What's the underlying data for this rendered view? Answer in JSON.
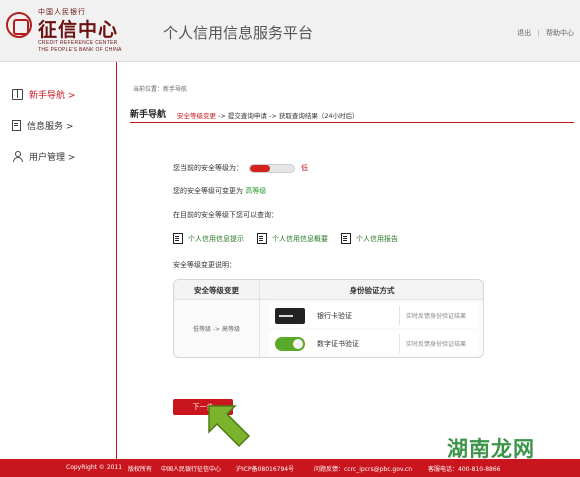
{
  "header": {
    "logo_top": "中国人民银行",
    "logo_cn": "征信中心",
    "logo_en_line1": "CREDIT REFERENCE CENTER",
    "logo_en_line2": "THE PEOPLE'S BANK OF CHINA",
    "platform_title": "个人信用信息服务平台",
    "logout_label": "退出",
    "separator": "|",
    "help_label": "帮助中心"
  },
  "sidebar": {
    "items": [
      {
        "label": "新手导航 >",
        "icon": "book-icon",
        "active": true
      },
      {
        "label": "信息服务 >",
        "icon": "document-icon",
        "active": false
      },
      {
        "label": "用户管理 >",
        "icon": "user-icon",
        "active": false
      }
    ]
  },
  "main": {
    "breadcrumb": "当前位置：新手导航",
    "section_title": "新手导航",
    "steps": {
      "current": "安全等级变更",
      "rest": " -> 提交查询申请 -> 获取查询结果（24小时后）"
    },
    "current_level_label": "您当前的安全等级为：",
    "current_level_value": "低",
    "current_level_fraction": 0.45,
    "upgrade_prefix": "您的安全等级可变更为",
    "upgrade_value": "高等级",
    "query_intro": "在目前的安全等级下您可以查询：",
    "query_items": [
      {
        "label": "个人信用信息提示",
        "icon": "document-icon"
      },
      {
        "label": "个人信用信息概要",
        "icon": "report-icon"
      },
      {
        "label": "个人信用报告",
        "icon": "book-icon"
      }
    ],
    "change_desc_label": "安全等级变更说明：",
    "table": {
      "col1_header": "安全等级变更",
      "col2_header": "身份验证方式",
      "level_change": "低等级 -> 高等级",
      "methods": [
        {
          "name": "银行卡验证",
          "icon": "bank-card-icon",
          "desc": "实时反馈身份验证结果"
        },
        {
          "name": "数字证书验证",
          "icon": "certificate-icon",
          "desc": "实时反馈身份验证结果"
        }
      ]
    },
    "next_button": "下一步"
  },
  "footer": {
    "copyright": "CopyRight © 2011",
    "rights": "版权所有",
    "org": "中国人民银行征信中心",
    "icp": "沪ICP备08016794号",
    "feedback": "问题反馈：ccrc_ipcrs@pbc.gov.cn",
    "hotline": "客服电话：400-810-8866"
  },
  "watermark": "湖南龙网",
  "colors": {
    "brand_red": "#c9151e",
    "success_green": "#2a9a2a",
    "header_bg": "#f1f1f1"
  }
}
